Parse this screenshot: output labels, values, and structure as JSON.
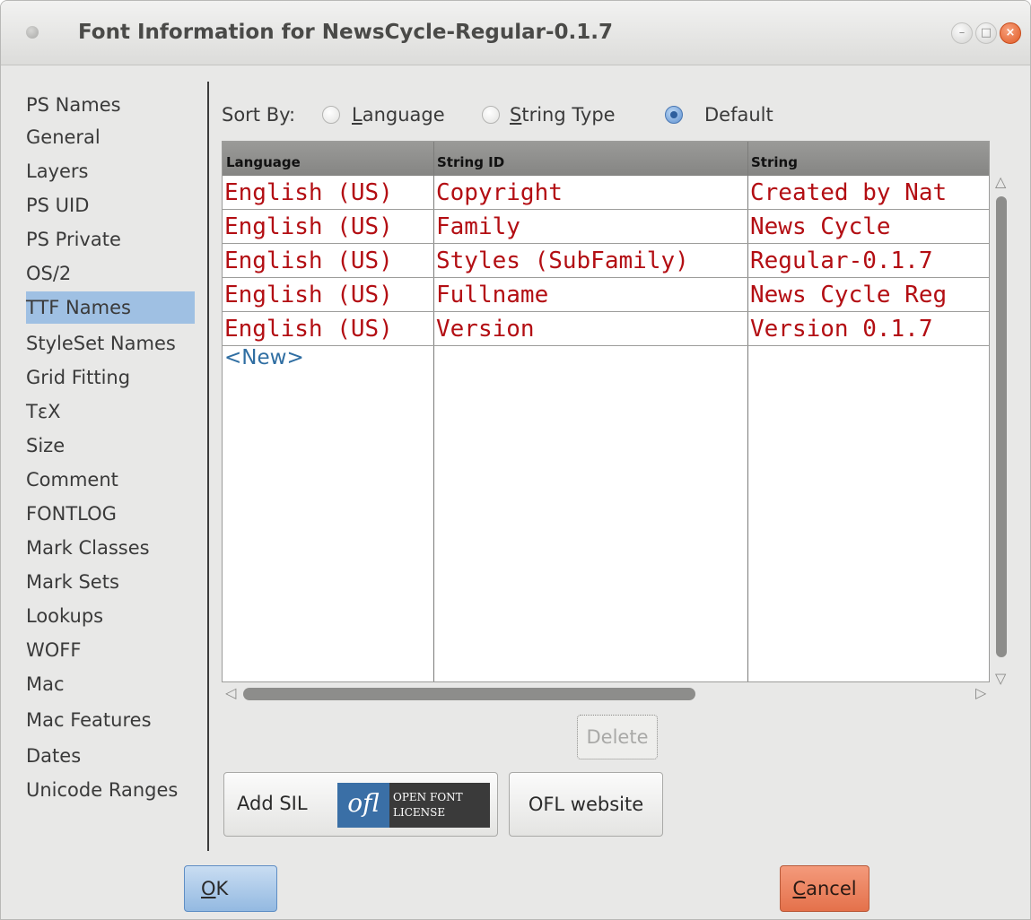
{
  "window": {
    "title": "Font Information for NewsCycle-Regular-0.1.7",
    "controls": {
      "minimize": "–",
      "maximize": "□",
      "close": "×"
    }
  },
  "sidebar": {
    "selected": "TTF Names",
    "items": [
      "PS Names",
      "General",
      "Layers",
      "PS UID",
      "PS Private",
      "OS/2",
      "TTF Names",
      "StyleSet Names",
      "Grid Fitting",
      "TεX",
      "Size",
      "Comment",
      "FONTLOG",
      "Mark Classes",
      "Mark Sets",
      "Lookups",
      "WOFF",
      "Mac",
      "Mac Features",
      "Dates",
      "Unicode Ranges"
    ]
  },
  "sort": {
    "label": "Sort By:",
    "options": [
      {
        "label_prefix": "",
        "mnemonic": "L",
        "label_rest": "anguage",
        "selected": false
      },
      {
        "label_prefix": "",
        "mnemonic": "S",
        "label_rest": "tring Type",
        "selected": false
      },
      {
        "label_prefix": "Default",
        "mnemonic": "",
        "label_rest": "",
        "selected": true
      }
    ]
  },
  "table": {
    "columns": [
      "Language",
      "String ID",
      "String"
    ],
    "rows": [
      [
        "English (US)",
        "Copyright",
        "Created by Nat"
      ],
      [
        "English (US)",
        "Family",
        "News Cycle"
      ],
      [
        "English (US)",
        "Styles (SubFamily)",
        "Regular-0.1.7"
      ],
      [
        "English (US)",
        "Fullname",
        "News Cycle Reg"
      ],
      [
        "English (US)",
        "Version",
        "Version 0.1.7"
      ]
    ],
    "new_row_label": "<New>",
    "scroll_arrows": {
      "up": "△",
      "down": "▽",
      "left": "◁",
      "right": "▷"
    }
  },
  "buttons": {
    "delete": "Delete",
    "add_sil": "Add SIL",
    "ofl_logo": "ofl",
    "ofl_line1": "OPEN FONT",
    "ofl_line2": "LICENSE",
    "ofl_website": "OFL website",
    "ok_mnemonic": "O",
    "ok_rest": "K",
    "cancel_mnemonic": "C",
    "cancel_rest": "ancel"
  },
  "colors": {
    "selection": "#9fc0e3",
    "table_text": "#b30e13",
    "new_row": "#2f6ea2",
    "ok_button": "#93b9e1",
    "cancel_button": "#e4714b"
  }
}
